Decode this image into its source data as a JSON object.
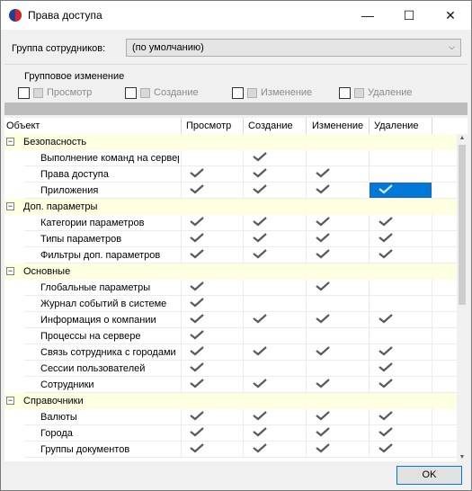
{
  "window": {
    "title": "Права доступа",
    "minimize": "—",
    "maximize": "☐",
    "close": "✕"
  },
  "group": {
    "label": "Группа сотрудников:",
    "value": "(по умолчанию)"
  },
  "group_change": {
    "title": "Групповое изменение",
    "items": [
      {
        "label": "Просмотр"
      },
      {
        "label": "Создание"
      },
      {
        "label": "Изменение"
      },
      {
        "label": "Удаление"
      }
    ]
  },
  "grid": {
    "columns": [
      "Объект",
      "Просмотр",
      "Создание",
      "Изменение",
      "Удаление"
    ],
    "rows": [
      {
        "type": "group",
        "label": "Безопасность"
      },
      {
        "type": "item",
        "label": "Выполнение команд на сервере",
        "view": false,
        "create": true,
        "edit": false,
        "delete": false
      },
      {
        "type": "item",
        "label": "Права доступа",
        "view": true,
        "create": true,
        "edit": true,
        "delete": false
      },
      {
        "type": "item",
        "label": "Приложения",
        "view": true,
        "create": true,
        "edit": true,
        "delete": true,
        "selected": "delete"
      },
      {
        "type": "group",
        "label": "Доп. параметры"
      },
      {
        "type": "item",
        "label": "Категории параметров",
        "view": true,
        "create": true,
        "edit": true,
        "delete": true
      },
      {
        "type": "item",
        "label": "Типы параметров",
        "view": true,
        "create": true,
        "edit": true,
        "delete": true
      },
      {
        "type": "item",
        "label": "Фильтры доп. параметров",
        "view": true,
        "create": true,
        "edit": true,
        "delete": true
      },
      {
        "type": "group",
        "label": "Основные"
      },
      {
        "type": "item",
        "label": "Глобальные параметры",
        "view": true,
        "create": false,
        "edit": true,
        "delete": false
      },
      {
        "type": "item",
        "label": "Журнал событий в системе",
        "view": true,
        "create": false,
        "edit": false,
        "delete": false
      },
      {
        "type": "item",
        "label": "Информация о компании",
        "view": true,
        "create": true,
        "edit": true,
        "delete": true
      },
      {
        "type": "item",
        "label": "Процессы на сервере",
        "view": true,
        "create": false,
        "edit": false,
        "delete": false
      },
      {
        "type": "item",
        "label": "Связь сотрудника с городами",
        "view": true,
        "create": true,
        "edit": true,
        "delete": true
      },
      {
        "type": "item",
        "label": "Сессии пользователей",
        "view": true,
        "create": false,
        "edit": false,
        "delete": true
      },
      {
        "type": "item",
        "label": "Сотрудники",
        "view": true,
        "create": true,
        "edit": true,
        "delete": true
      },
      {
        "type": "group",
        "label": "Справочники"
      },
      {
        "type": "item",
        "label": "Валюты",
        "view": true,
        "create": true,
        "edit": true,
        "delete": true
      },
      {
        "type": "item",
        "label": "Города",
        "view": true,
        "create": true,
        "edit": true,
        "delete": true
      },
      {
        "type": "item",
        "label": "Группы документов",
        "view": true,
        "create": true,
        "edit": true,
        "delete": true
      }
    ]
  },
  "buttons": {
    "ok": "OK"
  },
  "colors": {
    "group_row": "#fefee0",
    "selection": "#0078d7",
    "check": "#5a5a5a"
  }
}
